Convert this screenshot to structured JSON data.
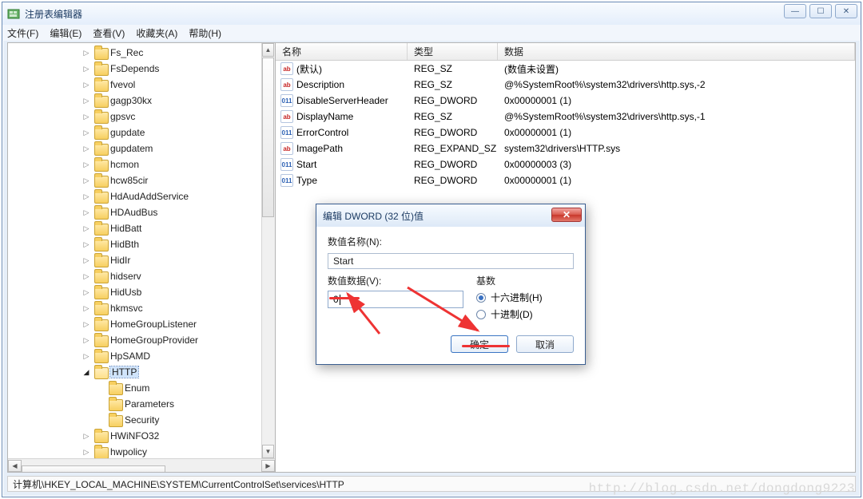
{
  "window": {
    "title": "注册表编辑器"
  },
  "menu": {
    "file": "文件(F)",
    "edit": "编辑(E)",
    "view": "查看(V)",
    "fav": "收藏夹(A)",
    "help": "帮助(H)"
  },
  "tree": [
    {
      "d": 1,
      "e": "c",
      "n": "Fs_Rec"
    },
    {
      "d": 1,
      "e": "c",
      "n": "FsDepends"
    },
    {
      "d": 1,
      "e": "c",
      "n": "fvevol"
    },
    {
      "d": 1,
      "e": "c",
      "n": "gagp30kx"
    },
    {
      "d": 1,
      "e": "c",
      "n": "gpsvc"
    },
    {
      "d": 1,
      "e": "c",
      "n": "gupdate"
    },
    {
      "d": 1,
      "e": "c",
      "n": "gupdatem"
    },
    {
      "d": 1,
      "e": "c",
      "n": "hcmon"
    },
    {
      "d": 1,
      "e": "c",
      "n": "hcw85cir"
    },
    {
      "d": 1,
      "e": "c",
      "n": "HdAudAddService"
    },
    {
      "d": 1,
      "e": "c",
      "n": "HDAudBus"
    },
    {
      "d": 1,
      "e": "c",
      "n": "HidBatt"
    },
    {
      "d": 1,
      "e": "c",
      "n": "HidBth"
    },
    {
      "d": 1,
      "e": "c",
      "n": "HidIr"
    },
    {
      "d": 1,
      "e": "c",
      "n": "hidserv"
    },
    {
      "d": 1,
      "e": "c",
      "n": "HidUsb"
    },
    {
      "d": 1,
      "e": "c",
      "n": "hkmsvc"
    },
    {
      "d": 1,
      "e": "c",
      "n": "HomeGroupListener"
    },
    {
      "d": 1,
      "e": "c",
      "n": "HomeGroupProvider"
    },
    {
      "d": 1,
      "e": "c",
      "n": "HpSAMD"
    },
    {
      "d": 1,
      "e": "o",
      "n": "HTTP",
      "sel": true
    },
    {
      "d": 2,
      "e": "n",
      "n": "Enum"
    },
    {
      "d": 2,
      "e": "n",
      "n": "Parameters"
    },
    {
      "d": 2,
      "e": "n",
      "n": "Security"
    },
    {
      "d": 1,
      "e": "c",
      "n": "HWiNFO32"
    },
    {
      "d": 1,
      "e": "c",
      "n": "hwpolicy"
    }
  ],
  "cols": {
    "name": "名称",
    "type": "类型",
    "data": "数据"
  },
  "rows": [
    {
      "ic": "sz",
      "n": "(默认)",
      "t": "REG_SZ",
      "d": "(数值未设置)"
    },
    {
      "ic": "sz",
      "n": "Description",
      "t": "REG_SZ",
      "d": "@%SystemRoot%\\system32\\drivers\\http.sys,-2"
    },
    {
      "ic": "dw",
      "n": "DisableServerHeader",
      "t": "REG_DWORD",
      "d": "0x00000001 (1)"
    },
    {
      "ic": "sz",
      "n": "DisplayName",
      "t": "REG_SZ",
      "d": "@%SystemRoot%\\system32\\drivers\\http.sys,-1"
    },
    {
      "ic": "dw",
      "n": "ErrorControl",
      "t": "REG_DWORD",
      "d": "0x00000001 (1)"
    },
    {
      "ic": "sz",
      "n": "ImagePath",
      "t": "REG_EXPAND_SZ",
      "d": "system32\\drivers\\HTTP.sys"
    },
    {
      "ic": "dw",
      "n": "Start",
      "t": "REG_DWORD",
      "d": "0x00000003 (3)"
    },
    {
      "ic": "dw",
      "n": "Type",
      "t": "REG_DWORD",
      "d": "0x00000001 (1)"
    }
  ],
  "dialog": {
    "title": "编辑 DWORD (32 位)值",
    "name_label": "数值名称(N):",
    "name_value": "Start",
    "data_label": "数值数据(V):",
    "data_value": "0",
    "base_label": "基数",
    "hex": "十六进制(H)",
    "dec": "十进制(D)",
    "ok": "确定",
    "cancel": "取消",
    "close": "✕"
  },
  "status": "计算机\\HKEY_LOCAL_MACHINE\\SYSTEM\\CurrentControlSet\\services\\HTTP",
  "watermark": "http://blog.csdn.net/dongdong9223"
}
